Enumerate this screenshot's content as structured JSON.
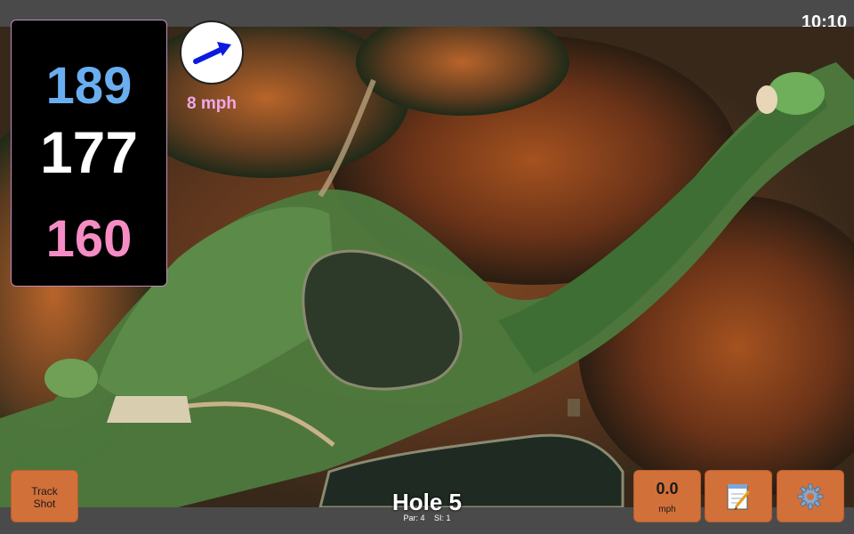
{
  "status_bar": {
    "time": "10:10"
  },
  "yardage": {
    "back": "189",
    "center": "177",
    "front": "160"
  },
  "wind": {
    "speed_label": "8 mph",
    "direction_icon": "arrow-northeast-icon"
  },
  "hole": {
    "title": "Hole 5",
    "par": "Par: 4",
    "stroke_index": "SI: 1"
  },
  "buttons": {
    "track_shot_line1": "Track",
    "track_shot_line2": "Shot",
    "speed_value": "0.0",
    "speed_unit": "mph",
    "notes_icon": "notepad-icon",
    "settings_icon": "gear-icon"
  },
  "colors": {
    "back_yardage": "#6aaef0",
    "center_yardage": "#ffffff",
    "front_yardage": "#f58cc4",
    "button_accent": "#d2703a",
    "wind_label": "#f0a8e8"
  }
}
